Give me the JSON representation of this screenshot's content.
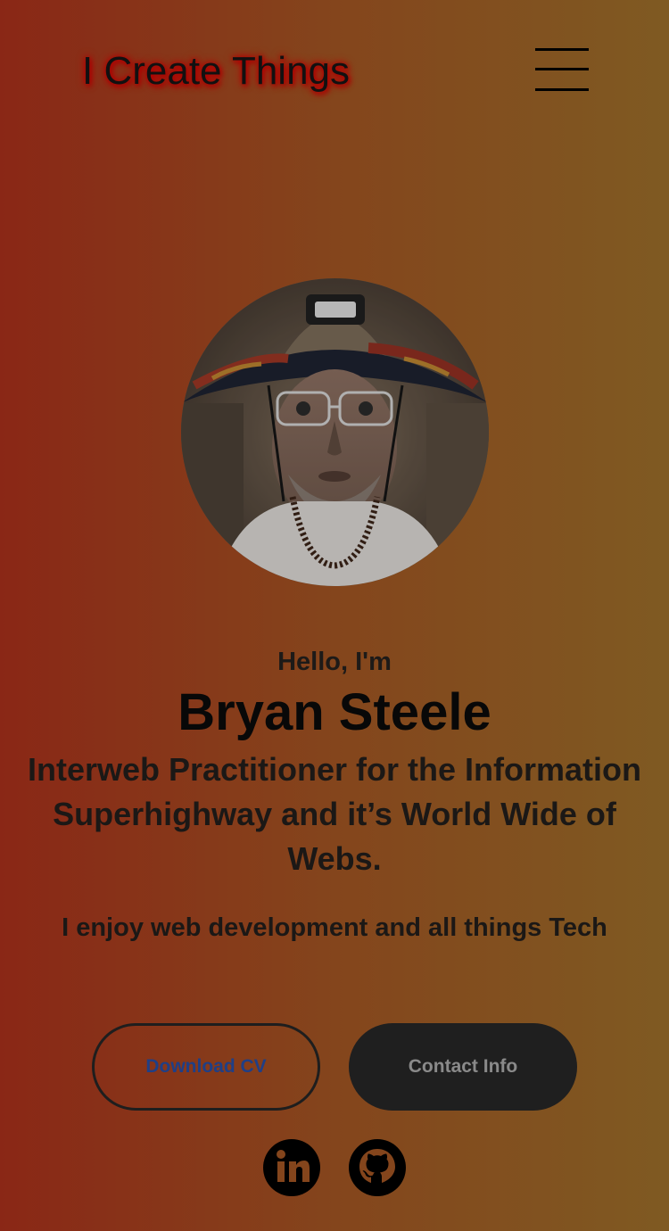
{
  "nav": {
    "logo_text": "I Create Things",
    "menu_icon": "hamburger-menu-icon"
  },
  "profile": {
    "photo_alt": "Profile photo"
  },
  "hero": {
    "greeting": "Hello, I'm",
    "name": "Bryan Steele",
    "tagline": "Interweb Practitioner for the Information Superhighway and it’s World Wide of Webs.",
    "about": "I enjoy web development and all things Tech"
  },
  "buttons": {
    "download_cv": "Download CV",
    "contact_info": "Contact Info"
  },
  "social": {
    "icons": [
      "linkedin-icon",
      "github-icon"
    ]
  },
  "colors": {
    "gradient_left": "#8a2716",
    "gradient_right": "#7f5a22",
    "logo_glow": "#b00000",
    "cv_text": "#1f3f86",
    "contact_bg": "#1f1f1f"
  }
}
